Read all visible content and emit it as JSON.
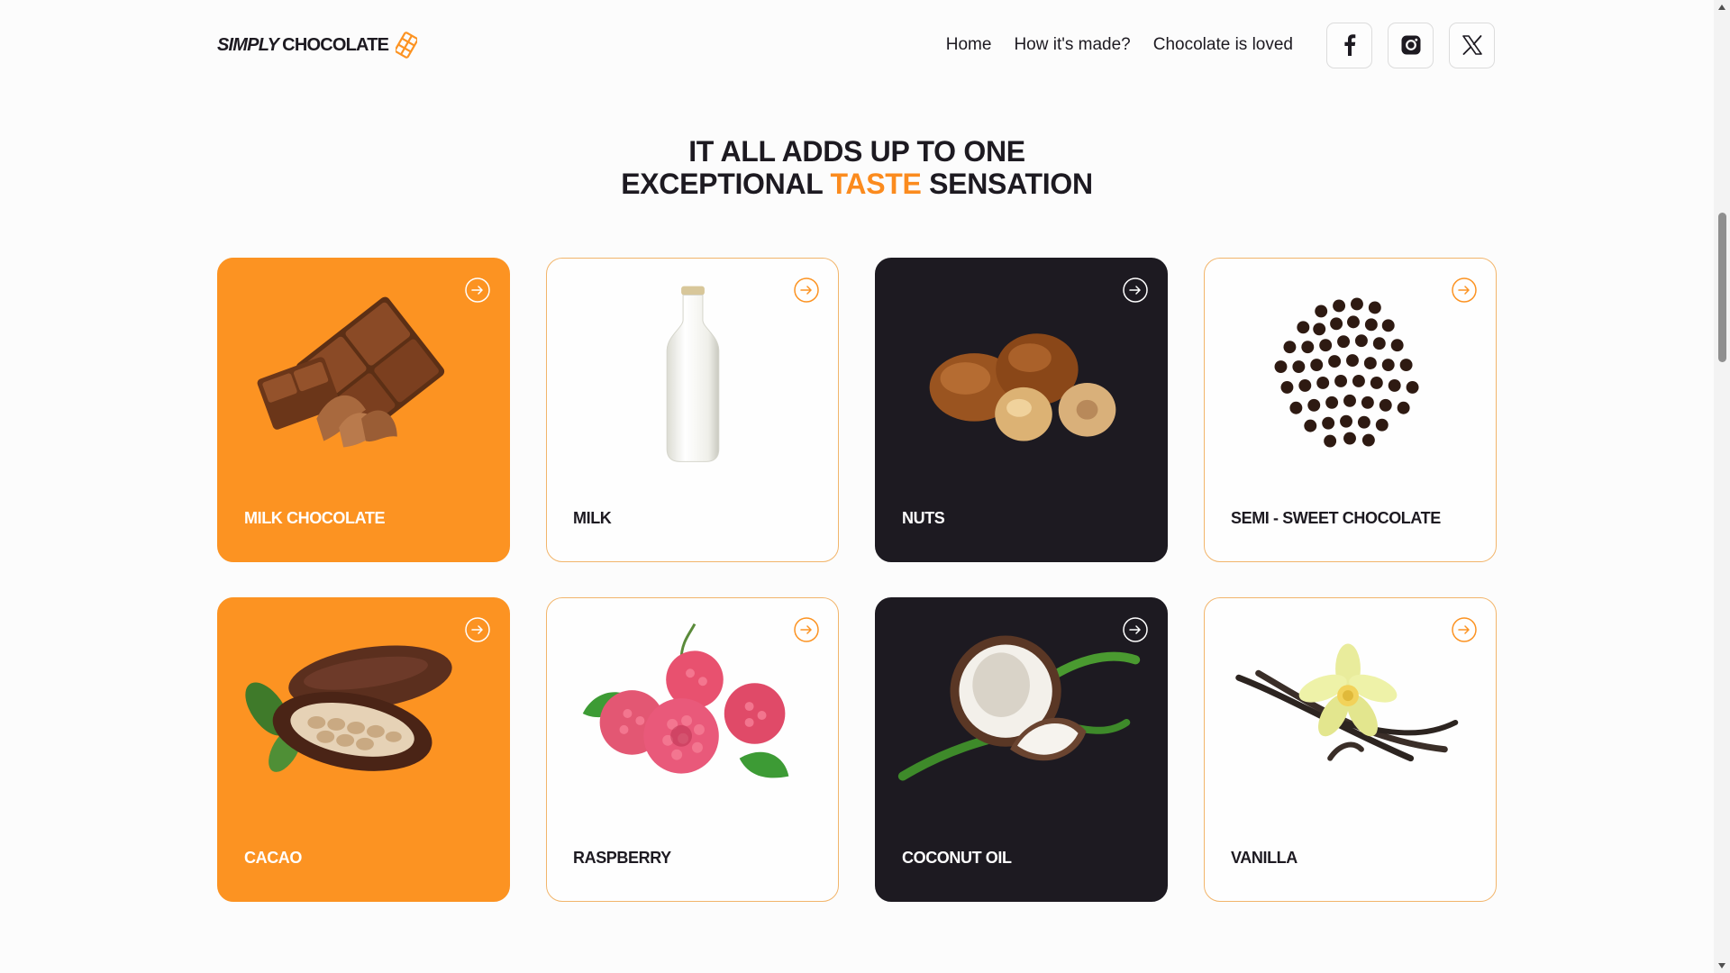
{
  "brand": {
    "name_italic": "SIMPLY",
    "name_rest": "CHOCOLATE",
    "logo_icon": "chocolate-bar-icon",
    "accent_color": "#fc9322",
    "dark_color": "#1d1a21"
  },
  "nav": {
    "items": [
      {
        "label": "Home"
      },
      {
        "label": "How it's made?"
      },
      {
        "label": "Chocolate is loved"
      }
    ]
  },
  "socials": [
    {
      "name": "facebook",
      "icon": "facebook-icon"
    },
    {
      "name": "instagram",
      "icon": "instagram-icon"
    },
    {
      "name": "x",
      "icon": "x-icon"
    }
  ],
  "heading": {
    "line1": "IT ALL ADDS UP TO ONE",
    "line2_before": "EXCEPTIONAL",
    "line2_accent": "TASTE",
    "line2_after": "SENSATION"
  },
  "ingredients": [
    {
      "label": "MILK CHOCOLATE",
      "theme": "orange",
      "icon": "chocolate-pieces-image"
    },
    {
      "label": "MILK",
      "theme": "light",
      "icon": "milk-bottle-image"
    },
    {
      "label": "NUTS",
      "theme": "dark",
      "icon": "hazelnuts-image"
    },
    {
      "label": "SEMI - SWEET CHOCOLATE",
      "theme": "light",
      "icon": "chocolate-chips-image"
    },
    {
      "label": "CACAO",
      "theme": "orange",
      "icon": "cacao-pod-image"
    },
    {
      "label": "RASPBERRY",
      "theme": "light",
      "icon": "raspberries-image"
    },
    {
      "label": "COCONUT OIL",
      "theme": "dark",
      "icon": "coconut-image"
    },
    {
      "label": "VANILLA",
      "theme": "light",
      "icon": "vanilla-flower-image"
    }
  ]
}
